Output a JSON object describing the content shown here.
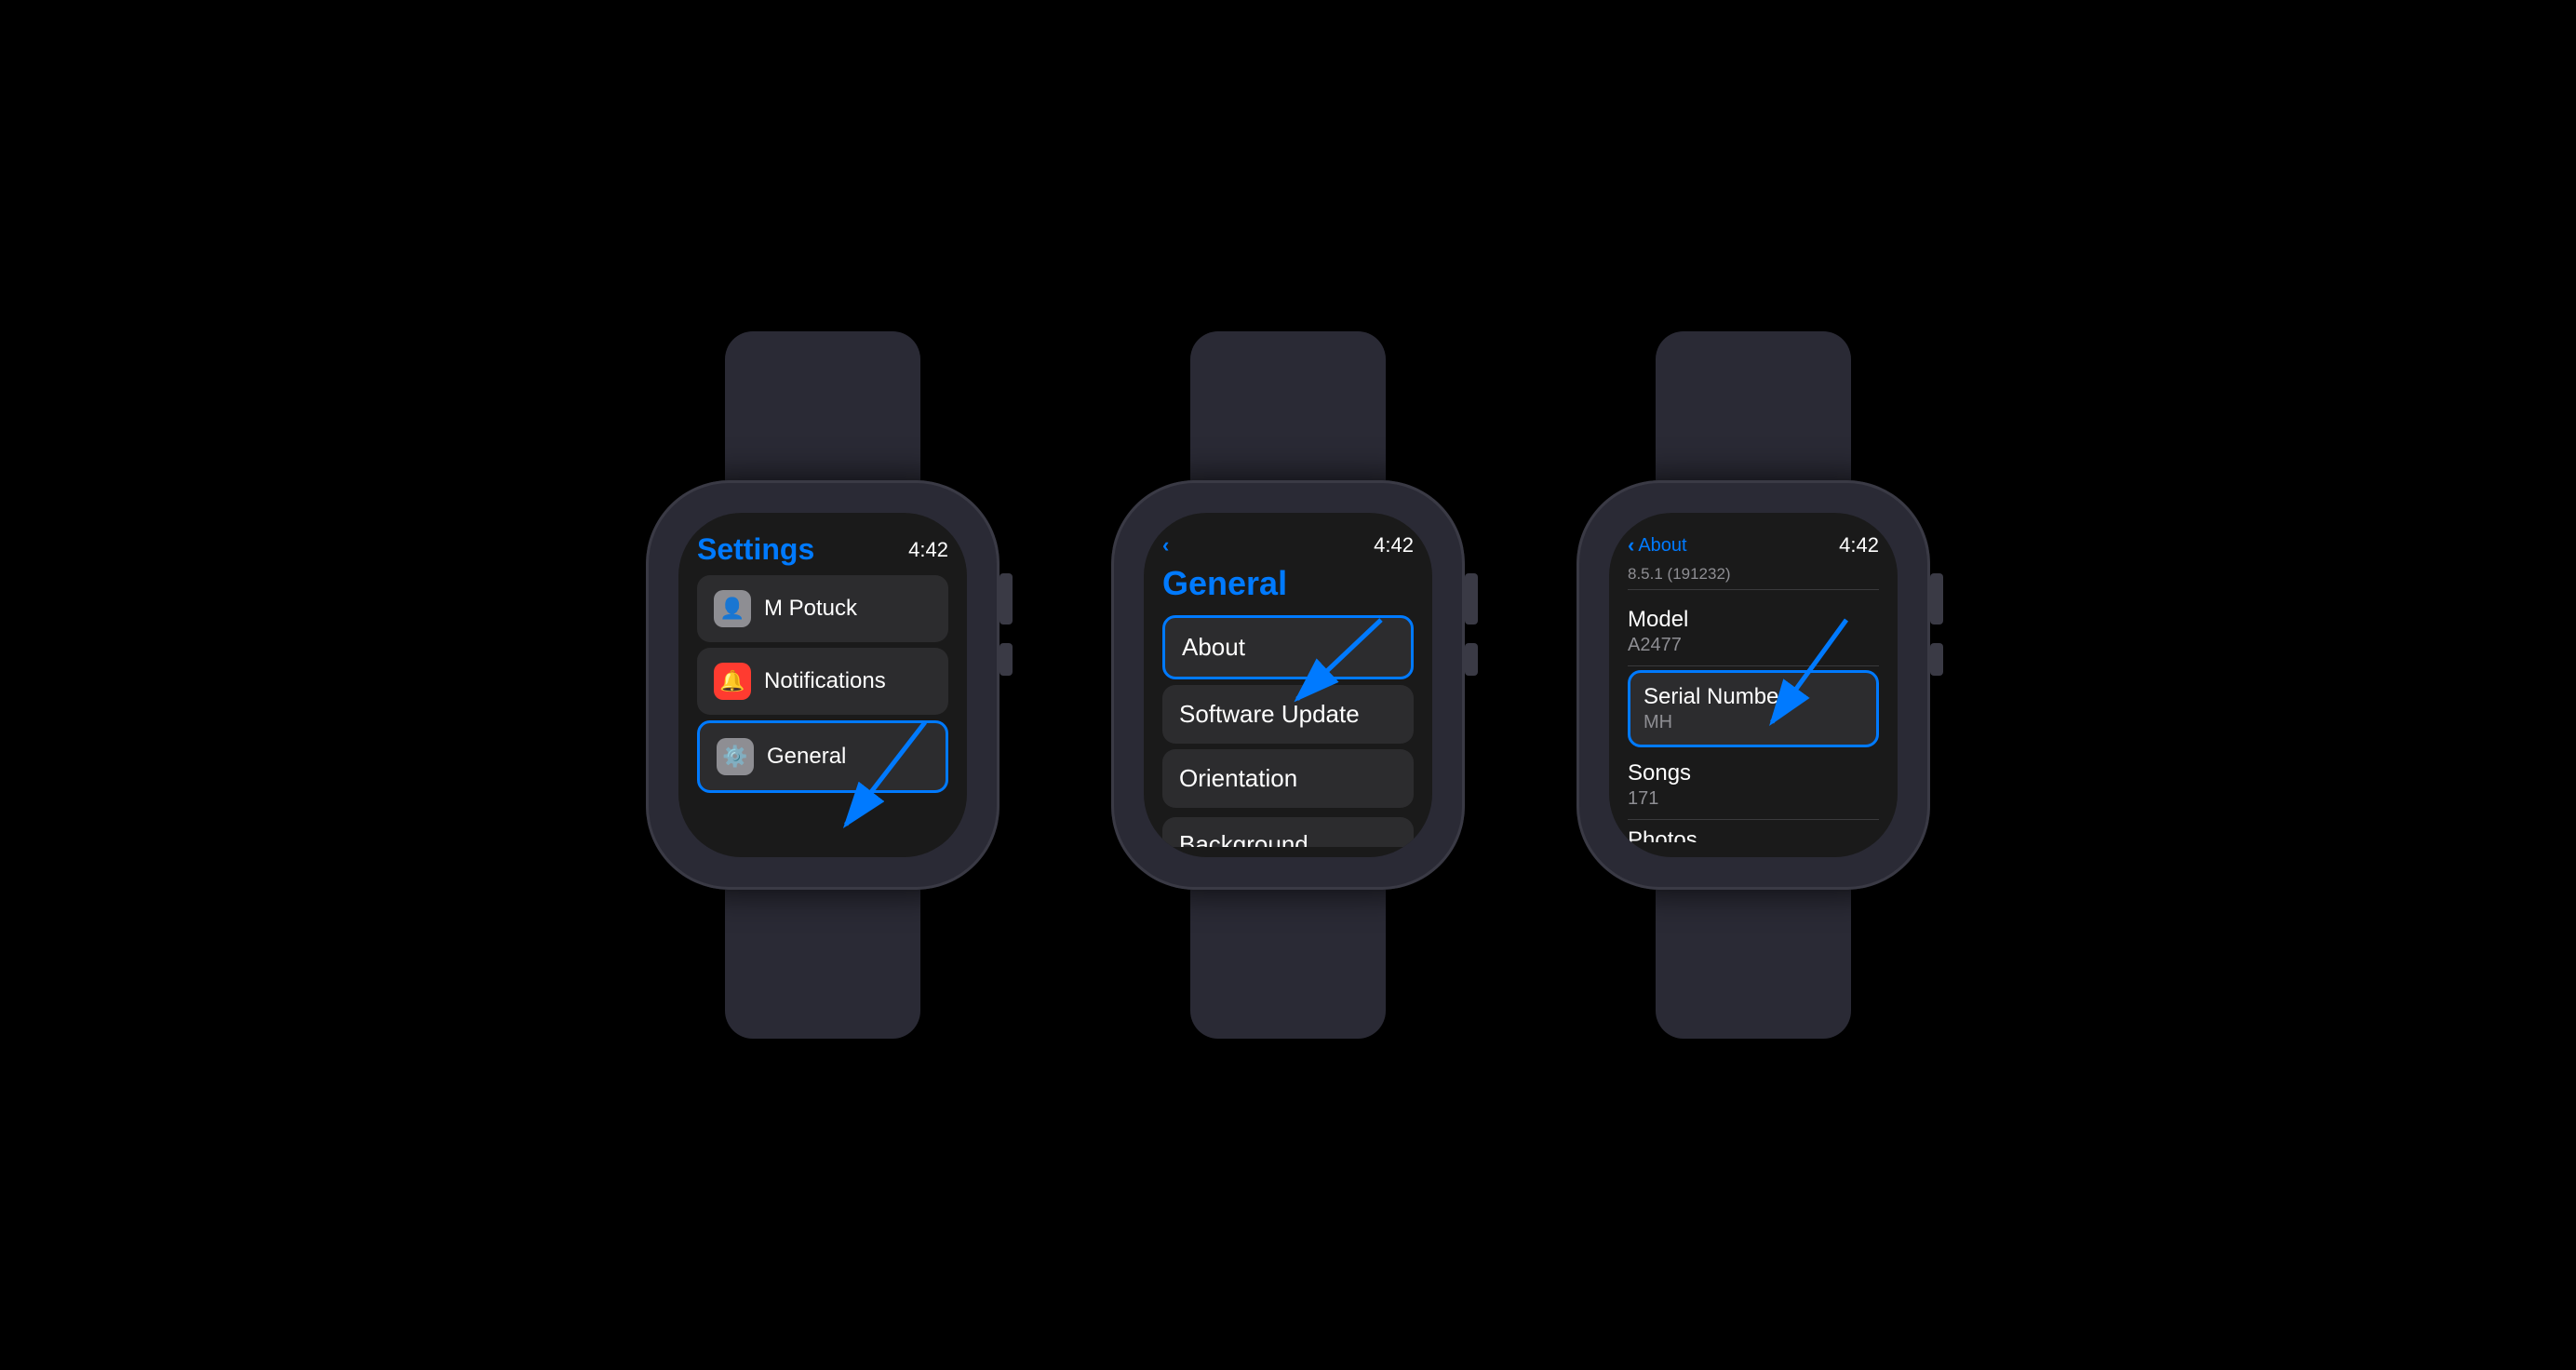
{
  "colors": {
    "accent": "#007AFF",
    "background": "#000000",
    "watchBody": "#2a2a35",
    "screenBg": "#1a1a1a",
    "menuItemBg": "#2c2c2e",
    "highlightBorder": "#007AFF",
    "textPrimary": "#ffffff",
    "textSecondary": "#8e8e93"
  },
  "watch1": {
    "time": "4:42",
    "title": "Settings",
    "items": [
      {
        "label": "M Potuck",
        "icon": "👤",
        "iconBg": "gray",
        "highlighted": false
      },
      {
        "label": "Notifications",
        "icon": "🔔",
        "iconBg": "red",
        "highlighted": false
      },
      {
        "label": "General",
        "icon": "⚙️",
        "iconBg": "gray",
        "highlighted": true
      }
    ]
  },
  "watch2": {
    "time": "4:42",
    "backLabel": "",
    "title": "General",
    "items": [
      {
        "label": "About",
        "highlighted": true
      },
      {
        "label": "Software Update",
        "highlighted": false
      },
      {
        "label": "Orientation",
        "highlighted": false
      },
      {
        "label": "Background",
        "highlighted": false,
        "partial": true
      }
    ]
  },
  "watch3": {
    "time": "4:42",
    "backLabel": "About",
    "versionText": "8.5.1 (191232)",
    "items": [
      {
        "label": "Model",
        "value": "A2477",
        "highlighted": false
      },
      {
        "label": "Serial Number",
        "value": "MH",
        "highlighted": true
      },
      {
        "label": "Songs",
        "value": "171",
        "highlighted": false
      },
      {
        "label": "Photos",
        "value": "",
        "highlighted": false,
        "partial": true
      }
    ]
  },
  "arrows": {
    "color": "#007AFF"
  }
}
